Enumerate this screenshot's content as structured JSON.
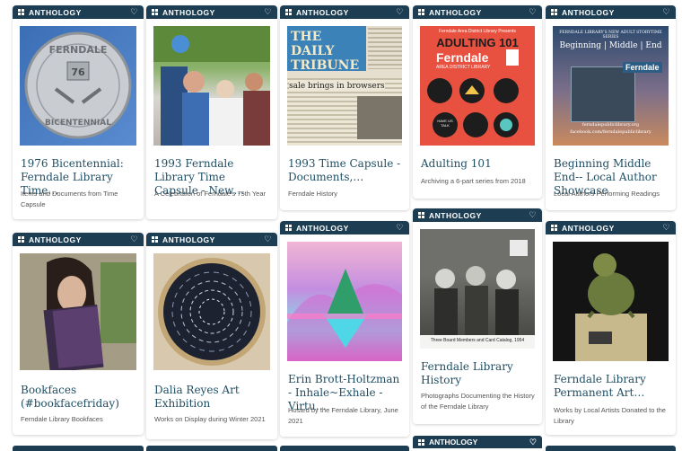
{
  "badge": "ANTHOLOGY",
  "colors": {
    "header": "#1d3d52",
    "title": "#1f4e63",
    "desc": "#555555"
  },
  "icons": {
    "collection": "grid-icon",
    "favorite": "heart-icon"
  },
  "cards": [
    {
      "title": "1976 Bicentennial: Ferndale Library Time…",
      "desc": "Items and Documents from Time Capsule",
      "coin_top": "FERNDALE",
      "coin_bottom": "BICENTENNIAL",
      "coin_year": "76"
    },
    {
      "title": "1993 Ferndale Library Time Capsule - New…",
      "desc": "A Celebration of Ferndale's 75th Year"
    },
    {
      "title": "1993 Time Capsule - Documents,…",
      "desc": "Ferndale History",
      "paper_title": "THE DAILY TRIBUNE",
      "paper_head": "sale brings in browsers"
    },
    {
      "title": "Adulting 101",
      "desc": "Archiving a 6-part series from 2018",
      "poster_small": "Ferndale Area District Library Presents",
      "poster_title": "ADULTING 101",
      "poster_brand": "Ferndale",
      "poster_sub": "AREA DISTRICT LIBRARY",
      "poster_bubble": "HAVE US TALK"
    },
    {
      "title": "Beginning Middle End-- Local Author Showcase",
      "desc": "Local Authors Performing Readings",
      "bme_top": "FERNDALE LIBRARY'S NEW ADULT STORYTIME SERIES",
      "bme_words": "Beginning | Middle | End",
      "bme_brand": "Ferndale",
      "bme_url": "ferndalepubliclibrary.org",
      "bme_fb": "facebook.com/ferndalepubliclibrary"
    },
    {
      "title": "Bookfaces (#bookfacefriday)",
      "desc": "Ferndale Library Bookfaces"
    },
    {
      "title": "Dalia Reyes Art Exhibition",
      "desc": "Works on Display during Winter 2021"
    },
    {
      "title": "Erin Brott-Holtzman - Inhale~Exhale - Virtu…",
      "desc": "Hosted by the Ferndale Library, June 2021"
    },
    {
      "title": "Ferndale Library History",
      "desc": "Photographs Documenting the History of the Ferndale Library",
      "caption": "Three Board Members and Card Catalog, 1954"
    },
    {
      "title": "Ferndale Library Permanent Art…",
      "desc": "Works by Local Artists Donated to the Library"
    }
  ]
}
